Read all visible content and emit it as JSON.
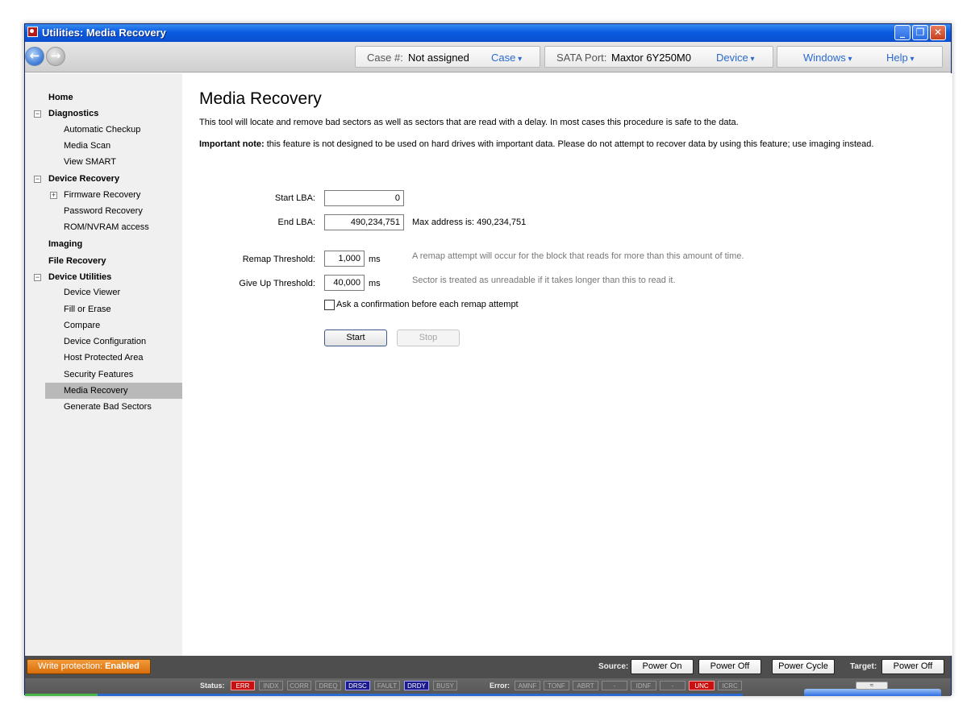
{
  "window": {
    "title": "Utilities: Media Recovery",
    "controls": {
      "minimize": "_",
      "maximize": "❐",
      "close": "✕"
    }
  },
  "toolbar": {
    "back_icon": "arrow-left-icon",
    "forward_icon": "arrow-right-icon",
    "case_label": "Case #:",
    "case_value": "Not assigned",
    "case_menu": "Case",
    "port_label": "SATA Port:",
    "port_value": "Maxtor 6Y250M0",
    "device_menu": "Device",
    "windows_menu": "Windows",
    "help_menu": "Help"
  },
  "sidebar": {
    "home": "Home",
    "diagnostics": "Diagnostics",
    "automatic_checkup": "Automatic Checkup",
    "media_scan": "Media Scan",
    "view_smart": "View SMART",
    "device_recovery": "Device Recovery",
    "firmware_recovery": "Firmware Recovery",
    "password_recovery": "Password Recovery",
    "rom_nvram": "ROM/NVRAM access",
    "imaging": "Imaging",
    "file_recovery": "File Recovery",
    "device_utilities": "Device Utilities",
    "device_viewer": "Device Viewer",
    "fill_or_erase": "Fill or Erase",
    "compare": "Compare",
    "device_configuration": "Device Configuration",
    "host_protected_area": "Host Protected Area",
    "security_features": "Security Features",
    "media_recovery": "Media Recovery",
    "generate_bad_sectors": "Generate Bad Sectors",
    "collapse_glyph": "−",
    "expand_glyph": "+"
  },
  "main": {
    "title": "Media Recovery",
    "description": "This tool will locate and remove bad sectors as well as sectors that are read with a delay. In most cases this procedure is safe to the data.",
    "note_bold": "Important note:",
    "note_text": " this feature is not designed to be used on hard drives with important data. Please do not attempt to recover data by using this feature; use imaging instead.",
    "start_lba_label": "Start LBA:",
    "start_lba_value": "0",
    "end_lba_label": "End LBA:",
    "end_lba_value": "490,234,751",
    "max_address": "Max address is:  490,234,751",
    "remap_label": "Remap Threshold:",
    "remap_value": "1,000",
    "remap_unit": "ms",
    "remap_hint": "A remap attempt will occur for the block that reads for more than this amount of time.",
    "giveup_label": "Give Up Threshold:",
    "giveup_value": "40,000",
    "giveup_unit": "ms",
    "giveup_hint": "Sector is treated as unreadable if it takes longer than this to read it.",
    "confirm_label": "Ask a confirmation before each remap attempt",
    "confirm_checked": false,
    "start_button": "Start",
    "stop_button": "Stop"
  },
  "actionbar": {
    "write_protection_label": "Write protection:",
    "write_protection_value": "Enabled",
    "source_label": "Source:",
    "power_on": "Power On",
    "power_off": "Power Off",
    "power_cycle": "Power Cycle",
    "target_label": "Target:",
    "target_power_off": "Power Off"
  },
  "statusbar": {
    "status_label": "Status:",
    "status_flags": [
      "ERR",
      "INDX",
      "CORR",
      "DREQ",
      "DRSC",
      "FAULT",
      "DRDY",
      "BUSY"
    ],
    "error_label": "Error:",
    "error_flags": [
      "AMNF",
      "TONF",
      "ABRT",
      "-",
      "IDNF",
      "-",
      "UNC",
      "ICRC"
    ],
    "collapse_glyph": "≈"
  },
  "colors": {
    "title_bar": "#0b5ce0",
    "accent_link": "#2a6ad0",
    "write_protect_orange": "#d86d0a",
    "flag_active_red": "#c81010",
    "flag_active_blue": "#1a1a8c",
    "sidebar_selected": "#b9b9b9"
  }
}
